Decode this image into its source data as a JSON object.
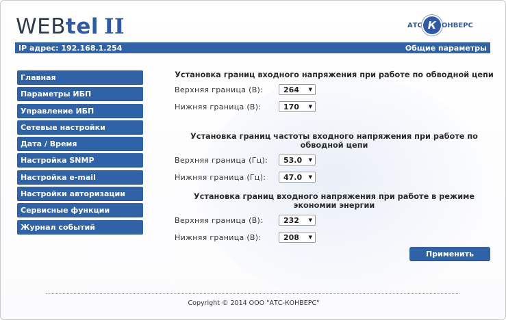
{
  "header": {
    "logo_web": "WEB",
    "logo_tel": "tel",
    "logo_ver": "II",
    "brand_left": "АТС",
    "brand_mark": "К",
    "brand_right": "ОНВЕРС",
    "ip_label": "IP адрес: 192.168.1.254",
    "page_title": "Общие параметры"
  },
  "nav": {
    "items": [
      "Главная",
      "Параметры ИБП",
      "Управление ИБП",
      "Сетевые настройки",
      "Дата / Время",
      "Настройка SNMP",
      "Настройка e-mail",
      "Настройки авторизации",
      "Сервисные функции",
      "Журнал событий"
    ]
  },
  "sections": [
    {
      "title": "Установка границ входного напряжения при работе по обводной цепи",
      "rows": [
        {
          "label": "Верхняя граница (В):",
          "value": "264"
        },
        {
          "label": "Нижняя граница (В):",
          "value": "170"
        }
      ]
    },
    {
      "title": "Установка границ частоты входного напряжения при работе по обводной цепи",
      "rows": [
        {
          "label": "Верхняя граница (Гц):",
          "value": "53.0"
        },
        {
          "label": "Нижняя граница (Гц):",
          "value": "47.0"
        }
      ]
    },
    {
      "title": "Установка границ входного напряжения при работе в режиме экономии энергии",
      "rows": [
        {
          "label": "Верхняя граница (В):",
          "value": "232"
        },
        {
          "label": "Нижняя граница (В):",
          "value": "208"
        }
      ]
    }
  ],
  "apply_label": "Применить",
  "footer": "Copyright © 2014 ООО \"АТС-КОНВЕРС\"",
  "colors": {
    "accent": "#3062a8"
  }
}
